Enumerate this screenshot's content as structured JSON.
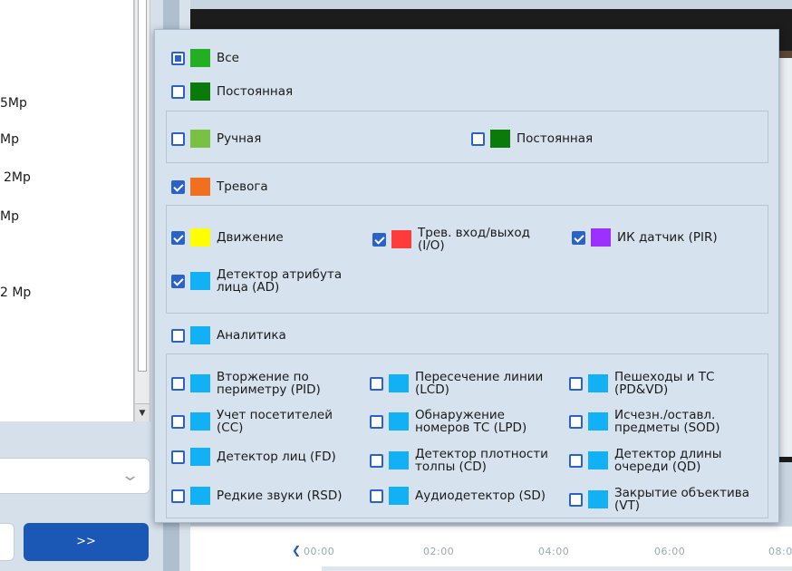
{
  "left_panel": {
    "resolutions": [
      {
        "label": "5Mp"
      },
      {
        "label": "Mp"
      },
      {
        "label": "2Mp"
      },
      {
        "label": "Mp"
      },
      {
        "label": "2 Mp"
      }
    ],
    "next_button_label": ">>"
  },
  "timeline": {
    "ticks": [
      "00:00",
      "02:00",
      "04:00",
      "06:00",
      "08:0"
    ]
  },
  "popup": {
    "all": {
      "label": "Все",
      "color": "#22b022"
    },
    "continuous": {
      "label": "Постоянная",
      "color": "#0a7a0a"
    },
    "manual": {
      "label": "Ручная",
      "color": "#7ac043"
    },
    "continuous_sub": {
      "label": "Постоянная",
      "color": "#0a7a0a"
    },
    "alarm": {
      "label": "Тревога",
      "color": "#f07020"
    },
    "motion": {
      "label": "Движение",
      "color": "#ffff00"
    },
    "alarm_io": {
      "label": "Трев. вход/выход (I/O)",
      "color": "#ff3b3b"
    },
    "pir": {
      "label": "ИК датчик (PIR)",
      "color": "#9b30ff"
    },
    "face_attr": {
      "label": "Детектор атрибута лица (AD)",
      "color": "#12b0f5"
    },
    "analytics": {
      "label": "Аналитика",
      "color": "#12b0f5"
    },
    "analytics_items": [
      {
        "label": "Вторжение по периметру (PID)"
      },
      {
        "label": "Пересечение линии (LCD)"
      },
      {
        "label": "Пешеходы и ТС (PD&VD)"
      },
      {
        "label": "Учет посетителей (CC)"
      },
      {
        "label": "Обнаружение номеров ТС (LPD)"
      },
      {
        "label": "Исчезн./оставл. предметы (SOD)"
      },
      {
        "label": "Детектор лиц (FD)"
      },
      {
        "label": "Детектор плотности толпы (CD)"
      },
      {
        "label": "Детектор длины очереди (QD)"
      },
      {
        "label": "Редкие звуки (RSD)"
      },
      {
        "label": "Аудиодетектор (SD)"
      },
      {
        "label": "Закрытие объектива (VT)"
      }
    ],
    "analytics_color": "#12b0f5"
  }
}
